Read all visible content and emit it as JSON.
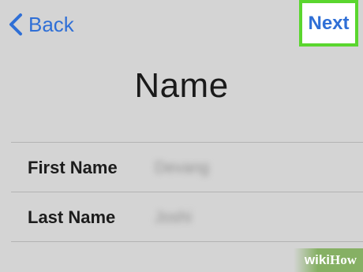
{
  "nav": {
    "back_label": "Back",
    "next_label": "Next",
    "accent_color": "#2f6fd6",
    "highlight_color": "#5ad62e",
    "back_icon": "chevron-left-icon"
  },
  "page": {
    "title": "Name"
  },
  "form": {
    "rows": [
      {
        "label": "First Name",
        "value": "Devang"
      },
      {
        "label": "Last Name",
        "value": "Joshi"
      }
    ]
  },
  "watermark": {
    "wiki": "wiki",
    "how": "How"
  }
}
